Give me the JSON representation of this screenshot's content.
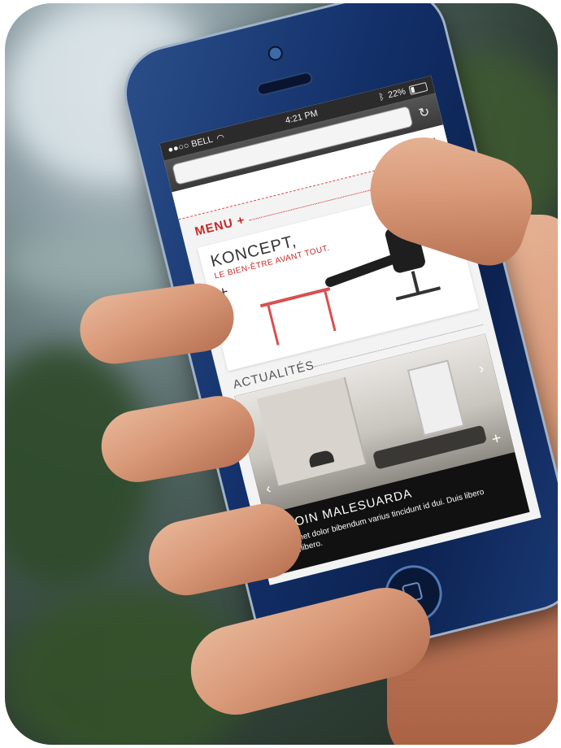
{
  "status_bar": {
    "carrier": "●●○○ BELL",
    "wifi_icon": "wifi-icon",
    "time": "4:21 PM",
    "bluetooth_icon": "bluetooth-icon",
    "battery_percent": "22%",
    "battery_level": 0.22
  },
  "browser": {
    "reload_icon": "reload-icon"
  },
  "page": {
    "toolbar": {
      "search_icon": "search-icon",
      "close_icon": "close-icon"
    },
    "menu_label": "MENU +",
    "hero": {
      "title": "KONCEPT,",
      "subtitle": "LE BIEN-ÊTRE AVANT TOUT.",
      "plus": "+"
    },
    "news": {
      "section_label": "ACTUALITÉS",
      "title": "PROIN MALESUARDA",
      "text": "Sit amet dolor bibendum varius tincidunt id dui. Duis libero eros,libero.",
      "plus": "+",
      "arrow_left_icon": "arrow-left-icon",
      "arrow_right_icon": "arrow-right-icon"
    },
    "accent_color": "#c62828"
  }
}
